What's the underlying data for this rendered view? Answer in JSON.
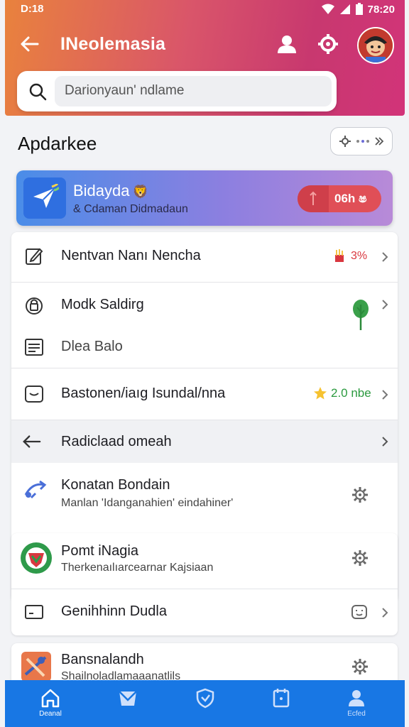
{
  "status": {
    "time": "D:18",
    "clock": "78:20"
  },
  "appbar": {
    "title": "INeolemasia"
  },
  "search": {
    "placeholder": "Darionyaun' ndlame"
  },
  "section": {
    "title": "Apdarkee"
  },
  "featured": {
    "title": "Bidayda",
    "emoji": "🦁",
    "subtitle": "& Cdaman Didmadaun",
    "pill_label": "06h ෂ"
  },
  "card1": {
    "items": [
      {
        "label": "Nentvan Nanı Nencha",
        "badge": "3%"
      },
      {
        "label": "Modk Saldirg"
      },
      {
        "label": "Dlea Balo"
      },
      {
        "label": "Bastonen/iaıg Isundal/nna",
        "badge": "2.0 nbe"
      }
    ]
  },
  "nav_row": {
    "label": "Radiclaad omeah"
  },
  "connect": {
    "title": "Konatan Bondain",
    "subtitle": "Manlan 'Idanganahien' eindahiner'"
  },
  "card2": {
    "items": [
      {
        "title": "Pomt iNagia",
        "subtitle": "Therkenaılıarcearnar Kajsiaan"
      },
      {
        "title": "Genihhinn Dudla"
      }
    ]
  },
  "card3": {
    "title": "Bansnalandh",
    "subtitle": "Shailnoladlamaaanatlils"
  },
  "bottom_nav": [
    {
      "label": "Deanal",
      "icon": "home-icon"
    },
    {
      "label": "",
      "icon": "inbox-icon"
    },
    {
      "label": "",
      "icon": "shield-icon"
    },
    {
      "label": "",
      "icon": "calendar-icon"
    },
    {
      "label": "Ecfed",
      "icon": "profile-icon"
    }
  ],
  "colors": {
    "header_start": "#e9823d",
    "header_end": "#d23479",
    "nav": "#1877e4",
    "featured": "#4a8de8",
    "badge_red": "#d9373f",
    "badge_green": "#2b9a3f"
  }
}
